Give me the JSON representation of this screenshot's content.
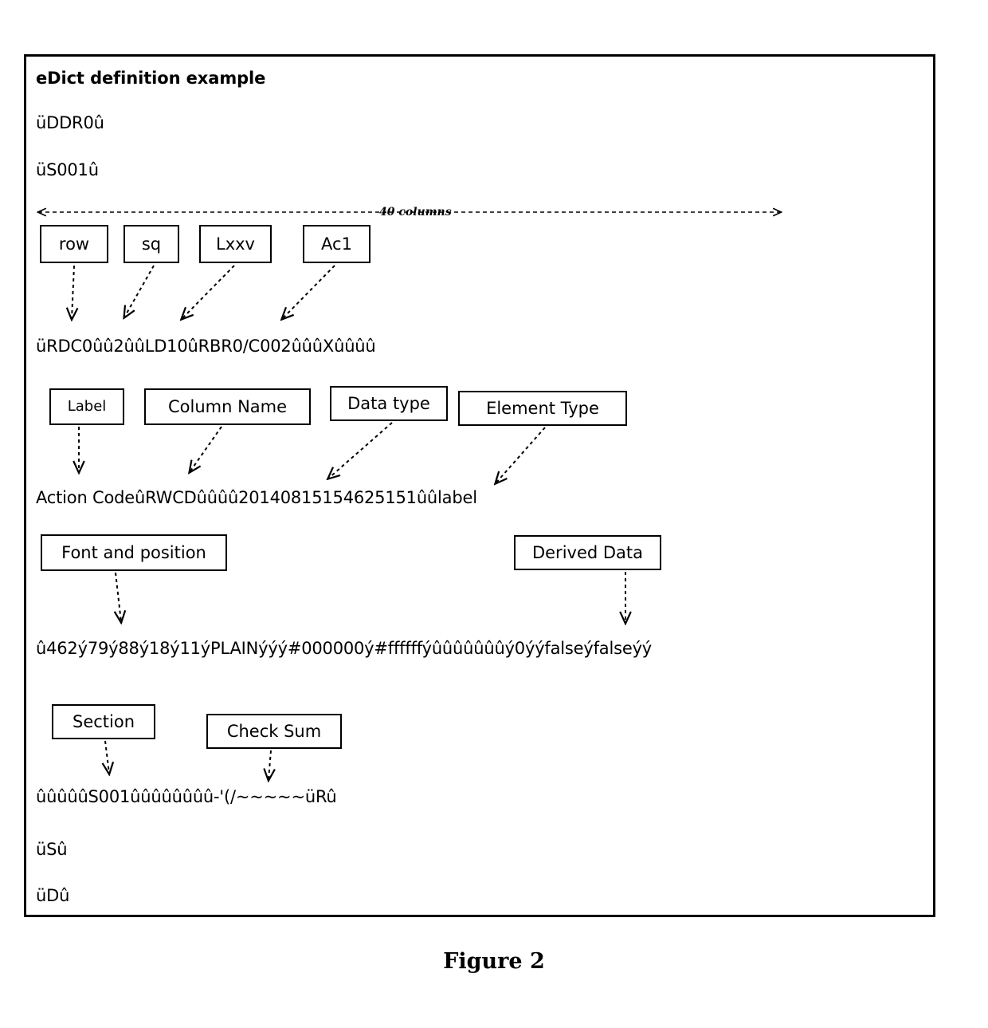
{
  "figure": {
    "caption": "Figure 2",
    "title": "eDict definition example"
  },
  "ruler": {
    "label": "40 columns"
  },
  "lines": {
    "header_record": "üDDR0û",
    "section_start": "üS001û",
    "rdc_record": "üRDC0ûû2ûûLD10ûRBR0/C002ûûûXûûûû",
    "action_code_record": "Action CodeûRWCDûûûû20140815154625151ûûlabel",
    "font_position_record": "û462ý79ý88ý18ý11ýPLAINýýý#000000ý#ffffffýûûûûûûûý0ýýfalseýfalseýý",
    "checksum_record": "ûûûûûS001ûûûûûûûû-'(/~~~~~üRû",
    "section_end": "üSû",
    "document_end": "üDû"
  },
  "callouts": {
    "row": "row",
    "sq": "sq",
    "lxxv": "Lxxv",
    "ac1": "Ac1",
    "label": "Label",
    "column_name": "Column Name",
    "data_type": "Data type",
    "element_type": "Element Type",
    "font_and_position": "Font and position",
    "derived_data": "Derived Data",
    "section": "Section",
    "check_sum": "Check Sum"
  },
  "colors": {
    "ink": "#000000",
    "paper": "#ffffff"
  }
}
